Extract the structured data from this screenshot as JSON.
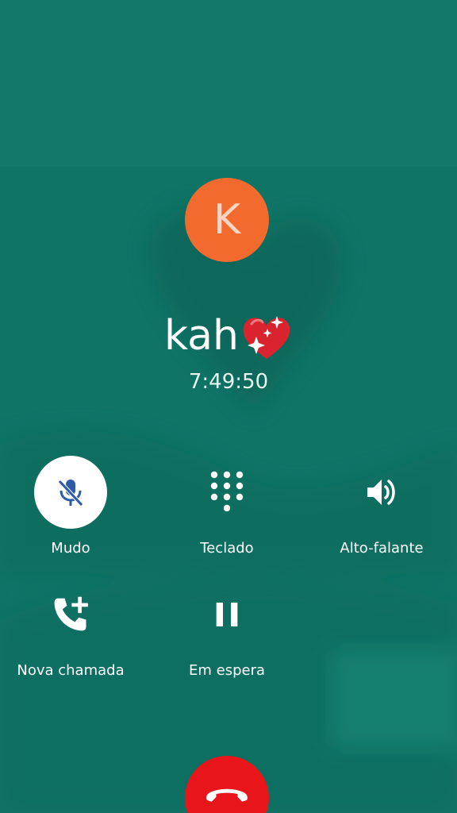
{
  "contact": {
    "initial": "K",
    "name": "kah",
    "name_emoji": "sparkling-heart-icon",
    "avatar_color": "#f26a2d"
  },
  "call": {
    "timer": "7:49:50"
  },
  "controls": [
    {
      "label": "Mudo",
      "icon": "mic-off-icon",
      "active": true
    },
    {
      "label": "Teclado",
      "icon": "dialpad-icon",
      "active": false
    },
    {
      "label": "Alto-falante",
      "icon": "speaker-icon",
      "active": false
    },
    {
      "label": "Nova chamada",
      "icon": "add-call-icon",
      "active": false
    },
    {
      "label": "Em espera",
      "icon": "pause-icon",
      "active": false
    }
  ],
  "colors": {
    "background": "#0f7466",
    "end_call": "#e8161a",
    "active_icon": "#2e5aa8"
  }
}
